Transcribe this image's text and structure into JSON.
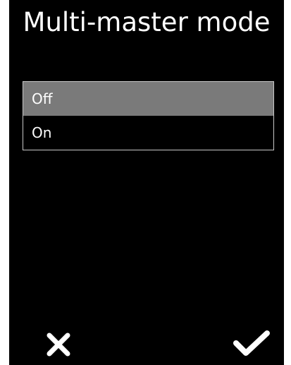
{
  "screen": {
    "title": "Multi-master mode"
  },
  "options": [
    {
      "label": "Off",
      "selected": true
    },
    {
      "label": "On",
      "selected": false
    }
  ],
  "actions": {
    "cancel_icon": "close-icon",
    "confirm_icon": "checkmark-icon"
  },
  "colors": {
    "background": "#000000",
    "text": "#ffffff",
    "selected_row": "#7a7a7a",
    "list_border": "#c8c8c8"
  }
}
